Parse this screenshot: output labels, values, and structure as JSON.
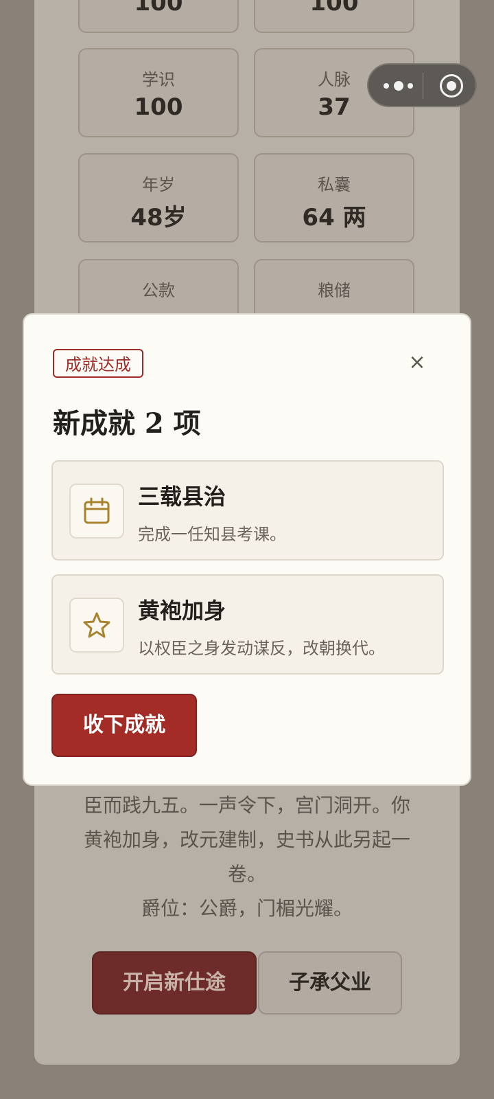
{
  "stats": [
    {
      "label": "",
      "value": "100"
    },
    {
      "label": "",
      "value": "100"
    },
    {
      "label": "学识",
      "value": "100"
    },
    {
      "label": "人脉",
      "value": "37"
    },
    {
      "label": "年岁",
      "value": "48岁"
    },
    {
      "label": "私囊",
      "value": "64 两"
    },
    {
      "label": "公款",
      "value": ""
    },
    {
      "label": "粮储",
      "value": ""
    }
  ],
  "story": {
    "line1": "臣而践九五。一声令下，宫门洞开。你",
    "line2": "黄袍加身，改元建制，史书从此另起一",
    "line3": "卷。",
    "line4": "爵位：公爵，门楣光耀。"
  },
  "actions": {
    "new_career": "开启新仕途",
    "inherit": "子承父业"
  },
  "modal": {
    "tag": "成就达成",
    "close": "×",
    "title": "新成就 2 项",
    "achievements": [
      {
        "icon": "calendar-icon",
        "name": "三载县治",
        "desc": "完成一任知县考课。"
      },
      {
        "icon": "star-icon",
        "name": "黄袍加身",
        "desc": "以权臣之身发动谋反，改朝换代。"
      }
    ],
    "accept": "收下成就"
  },
  "colors": {
    "accent": "#a32c27",
    "icon_gold": "#a8832e",
    "overlay": "#8a8278"
  }
}
